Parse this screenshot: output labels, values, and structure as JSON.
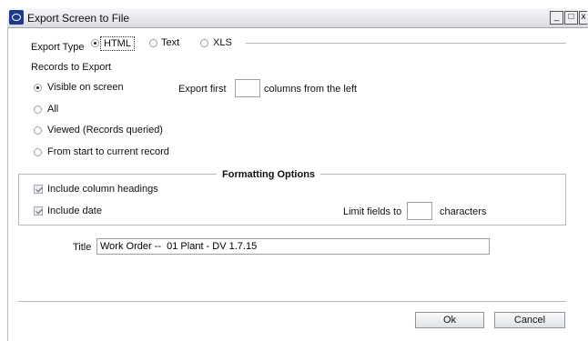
{
  "window": {
    "title": "Export Screen to File",
    "controls": {
      "minimize": "_",
      "maximize": "□",
      "close": "x"
    }
  },
  "export_type": {
    "label": "Export Type",
    "options": [
      {
        "label": "HTML",
        "selected": true
      },
      {
        "label": "Text",
        "selected": false
      },
      {
        "label": "XLS",
        "selected": false
      }
    ]
  },
  "records": {
    "label": "Records to Export",
    "options": [
      {
        "label": "Visible on screen",
        "selected": true
      },
      {
        "label": "All",
        "selected": false
      },
      {
        "label": "Viewed (Records queried)",
        "selected": false
      },
      {
        "label": "From start to current record",
        "selected": false
      }
    ]
  },
  "export_first": {
    "prefix": "Export first",
    "value": "",
    "suffix": "columns from the left"
  },
  "formatting": {
    "title": "Formatting Options",
    "include_headings": {
      "label": "Include column headings",
      "checked": true
    },
    "include_date": {
      "label": "Include date",
      "checked": true
    },
    "limit": {
      "prefix": "Limit fields to",
      "value": "",
      "suffix": "characters"
    }
  },
  "title_field": {
    "label": "Title",
    "value": "Work Order --  01 Plant - DV 1.7.15"
  },
  "buttons": {
    "ok": "Ok",
    "cancel": "Cancel"
  }
}
